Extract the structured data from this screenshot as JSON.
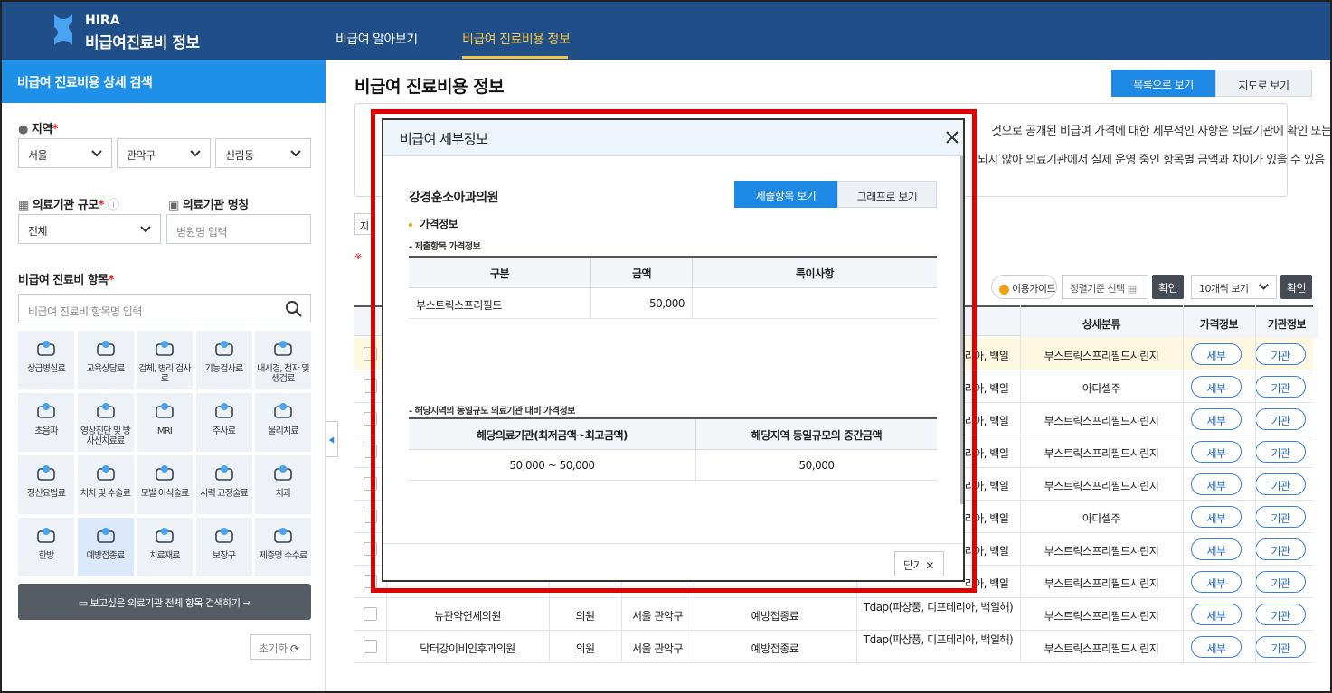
{
  "header": {
    "brand_en": "HIRA",
    "brand_kr": "비급여진료비 정보",
    "nav": [
      "비급여 알아보기",
      "비급여 진료비용 정보"
    ]
  },
  "sidebar": {
    "title": "비급여 진료비용 상세 검색",
    "region_label": "지역",
    "region": [
      "서울",
      "관악구",
      "신림동"
    ],
    "scale_label": "의료기관 규모",
    "scale_value": "전체",
    "name_label": "의료기관 명칭",
    "name_placeholder": "병원명 입력",
    "items_label": "비급여 진료비 항목",
    "items_placeholder": "비급여 진료비 항목명 입력",
    "categories": [
      "상급병실료",
      "교육상담료",
      "검체, 병리 검사료",
      "기능검사료",
      "내시경, 천자 및 생검료",
      "초음파",
      "영상진단 및 방사선치료료",
      "MRI",
      "주사료",
      "물리치료",
      "정신요법료",
      "처치 및 수술료",
      "모발 이식술료",
      "시력 교정술료",
      "치과",
      "한방",
      "예방접종료",
      "치료재료",
      "보장구",
      "제증명 수수료"
    ],
    "search_all": "보고싶은 의료기관 전체 항목 검색하기  →",
    "reset": "초기화"
  },
  "main": {
    "title": "비급여 진료비용 정보",
    "view_list": "목록으로 보기",
    "view_map": "지도로 보기",
    "notice1": "것으로 공개된 비급여 가격에 대한 세부적인 사항은 의료기관에 확인 또는",
    "notice2": "되지 않아 의료기관에서 실제 운영 중인 항목별 금액과 차이가 있을 수 있음",
    "filter_partial": "지",
    "warn_partial": "※",
    "guide": "이용가이드",
    "sort": "정렬기준 선택",
    "ok": "확인",
    "count": "10개씩 보기",
    "columns": [
      "상세분류",
      "가격정보",
      "기관정보"
    ],
    "rows": [
      {
        "detail": "부스트릭스프리필드시린지",
        "price": "세부",
        "org": "기관",
        "partial": "리아, 백일"
      },
      {
        "detail": "아다셀주",
        "price": "세부",
        "org": "기관",
        "partial": "리아, 백일"
      },
      {
        "detail": "부스트릭스프리필드시린지",
        "price": "세부",
        "org": "기관",
        "partial": "리아, 백일"
      },
      {
        "detail": "부스트릭스프리필드시린지",
        "price": "세부",
        "org": "기관",
        "partial": "리아, 백일"
      },
      {
        "detail": "부스트릭스프리필드시린지",
        "price": "세부",
        "org": "기관",
        "partial": "리아, 백일"
      },
      {
        "detail": "아다셀주",
        "price": "세부",
        "org": "기관",
        "partial": "리아, 백일"
      },
      {
        "detail": "부스트릭스프리필드시린지",
        "price": "세부",
        "org": "기관",
        "partial": "리아, 백일"
      },
      {
        "detail": "부스트릭스프리필드시린지",
        "price": "세부",
        "org": "기관",
        "partial": "리아, 백일"
      }
    ],
    "full_rows": [
      {
        "name": "뉴관악연세의원",
        "type": "의원",
        "region": "서울 관악구",
        "cat": "예방접종료",
        "item": "Tdap(파상풍, 디프테리아, 백일해)",
        "detail": "부스트릭스프리필드시린지",
        "price": "세부",
        "org": "기관"
      },
      {
        "name": "닥터강이비인후과의원",
        "type": "의원",
        "region": "서울 관악구",
        "cat": "예방접종료",
        "item": "Tdap(파상풍, 디프테리아, 백일해)",
        "detail": "부스트릭스프리필드시린지",
        "price": "세부",
        "org": "기관"
      }
    ]
  },
  "modal": {
    "title": "비급여 세부정보",
    "hospital": "강경훈소아과의원",
    "tab_items": "제출항목 보기",
    "tab_graph": "그래프로 보기",
    "section": "가격정보",
    "sub1": "- 제출항목 가격정보",
    "t1_headers": [
      "구분",
      "금액",
      "특이사항"
    ],
    "t1_row": {
      "name": "부스트릭스프리필드",
      "amount": "50,000",
      "note": ""
    },
    "sub2": "- 해당지역의 동일규모 의료기관 대비 가격정보",
    "t2_headers": [
      "해당의료기관(최저금액~최고금액)",
      "해당지역 동일규모의 중간금액"
    ],
    "t2_row": {
      "range": "50,000 ~ 50,000",
      "median": "50,000"
    },
    "close": "닫기"
  }
}
